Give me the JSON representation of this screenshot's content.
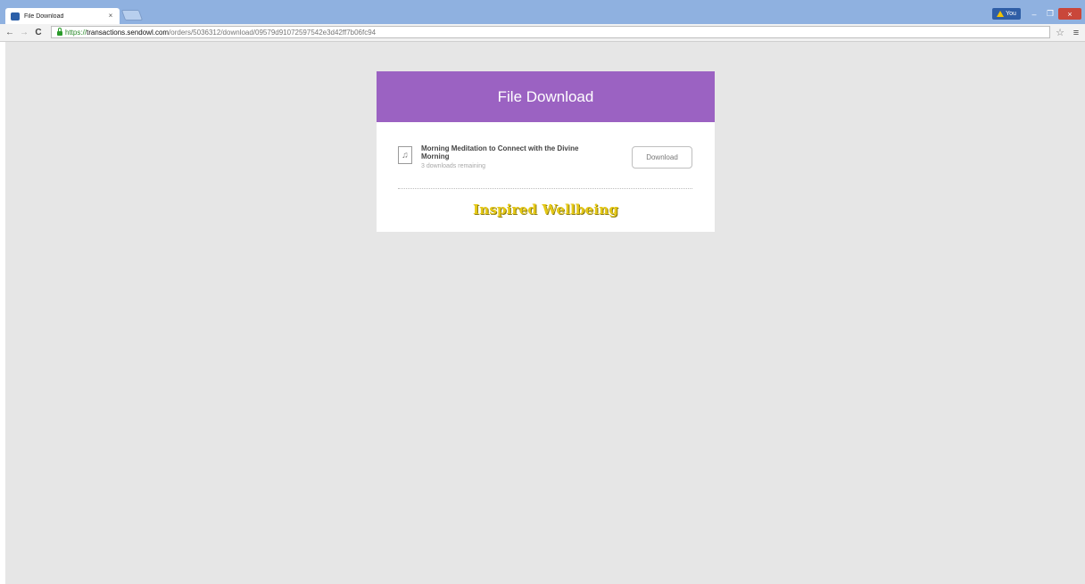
{
  "browser": {
    "tab": {
      "title": "File Download",
      "close_glyph": "×",
      "favicon": "sendowl-owl-icon"
    },
    "profile": {
      "name": "You",
      "icon": "warning-icon",
      "icon_color": "#f2c200"
    },
    "window_controls": {
      "minimize": "–",
      "maximize": "❐",
      "close": "×"
    },
    "nav": {
      "back": "←",
      "forward": "→",
      "reload": "C"
    },
    "url": {
      "scheme": "https://",
      "host": "transactions.sendowl.com",
      "path": "/orders/5036312/download/09579d91072597542e3d42ff7b06fc94"
    },
    "star_glyph": "☆",
    "menu_glyph": "≡"
  },
  "page": {
    "header": {
      "title": "File Download",
      "color": "#9b62c2"
    },
    "file": {
      "icon": "audio-file-icon",
      "icon_glyph": "♫",
      "name": "Morning Meditation to Connect with the Divine Morning",
      "remaining": "3 downloads remaining",
      "download_label": "Download"
    },
    "brand": {
      "name": "Inspired Wellbeing",
      "color": "#e6c916"
    },
    "background_color": "#e6e6e6"
  }
}
